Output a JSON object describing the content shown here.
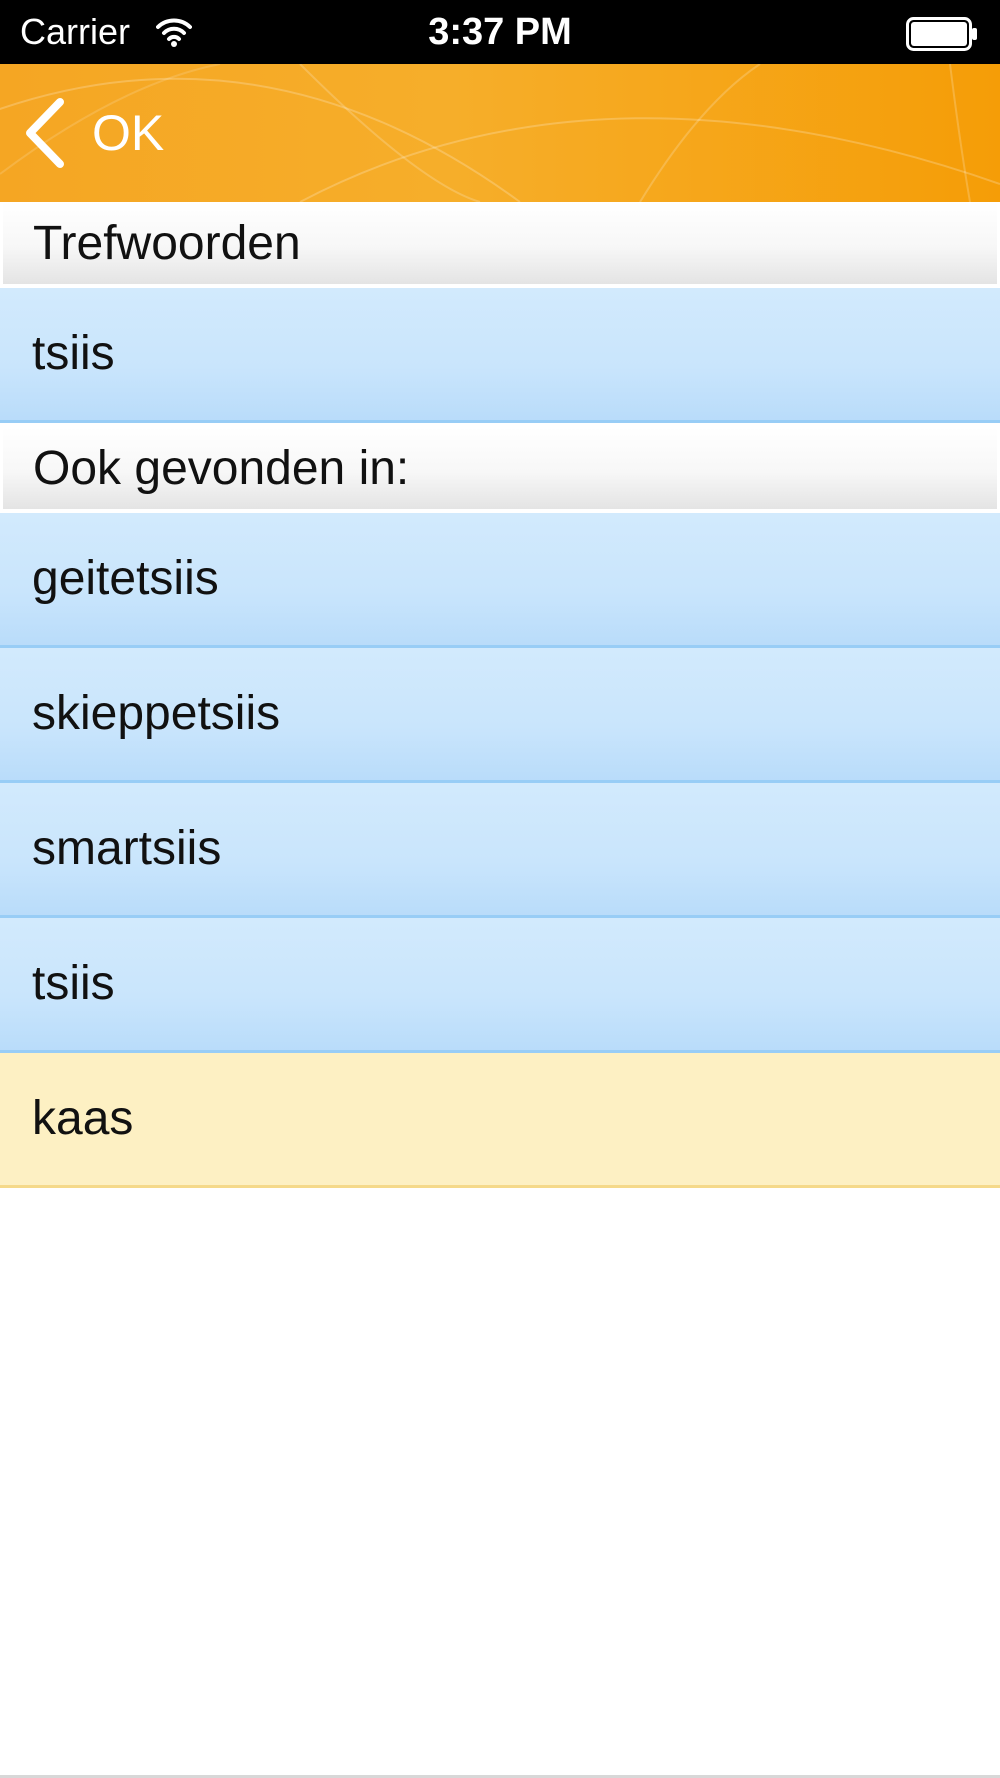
{
  "status_bar": {
    "carrier": "Carrier",
    "time": "3:37 PM",
    "wifi_icon": "wifi-icon",
    "battery_icon": "battery-icon"
  },
  "nav_bar": {
    "back_label": "OK",
    "back_icon": "chevron-left-icon",
    "background_color": "#f5a623"
  },
  "sections": [
    {
      "header": "Trefwoorden",
      "rows": [
        {
          "label": "tsiis"
        }
      ]
    },
    {
      "header": "Ook gevonden in:",
      "rows": [
        {
          "label": "geitetsiis"
        },
        {
          "label": "skieppetsiis"
        },
        {
          "label": "smartsiis"
        },
        {
          "label": "tsiis"
        },
        {
          "label": "kaas"
        }
      ]
    }
  ],
  "colors": {
    "row_blue": "#c9e5fc",
    "row_highlight": "#fdf0c3",
    "accent_orange": "#f5a623"
  }
}
